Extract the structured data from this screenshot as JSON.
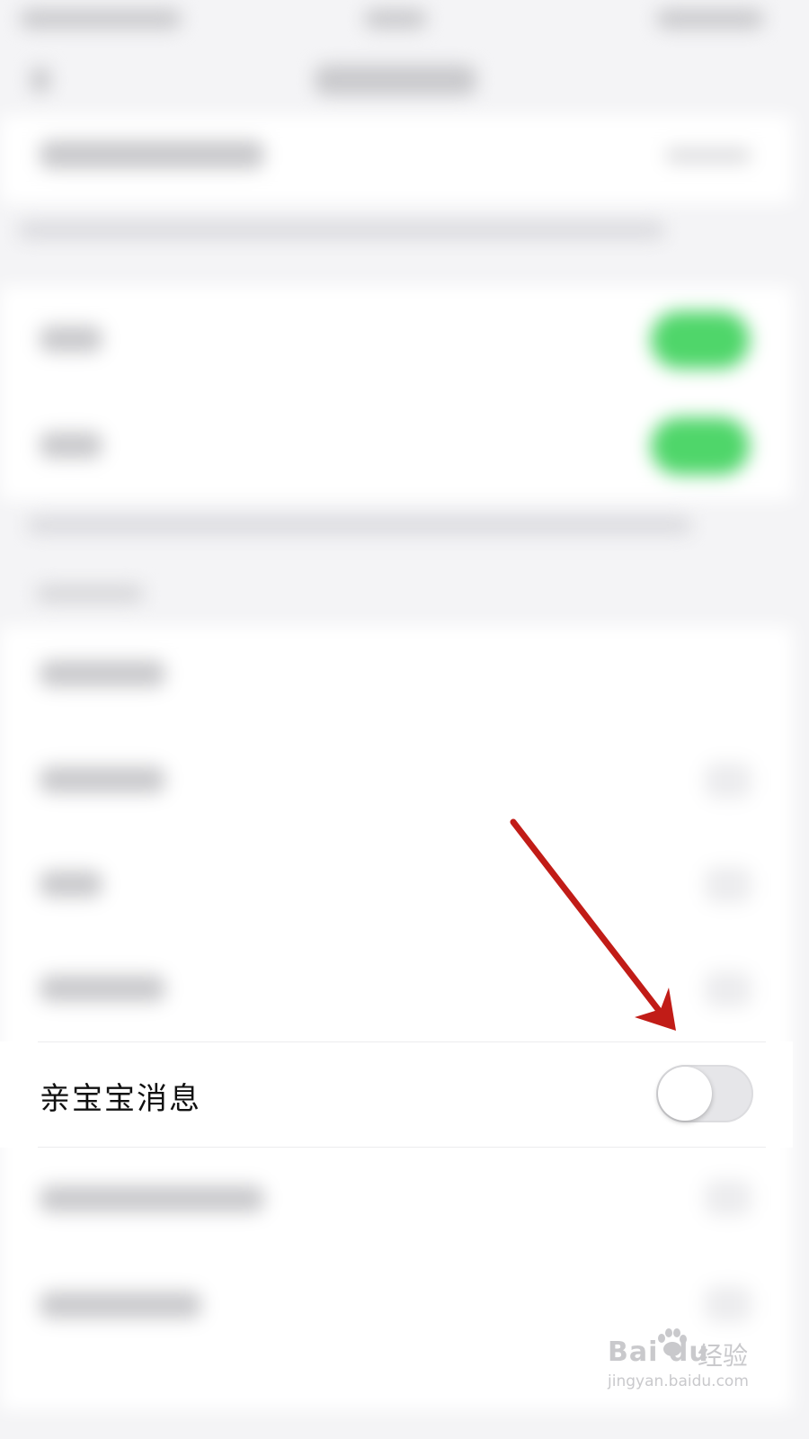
{
  "toggle_row": {
    "label": "亲宝宝消息",
    "enabled": false
  },
  "annotation": {
    "arrow_color": "#c11c17"
  },
  "watermark": {
    "logo": "Bai du",
    "name": "经验",
    "url": "jingyan.baidu.com"
  },
  "colors": {
    "switch_on": "#4fd66a",
    "switch_off_track": "#e6e6e9"
  }
}
